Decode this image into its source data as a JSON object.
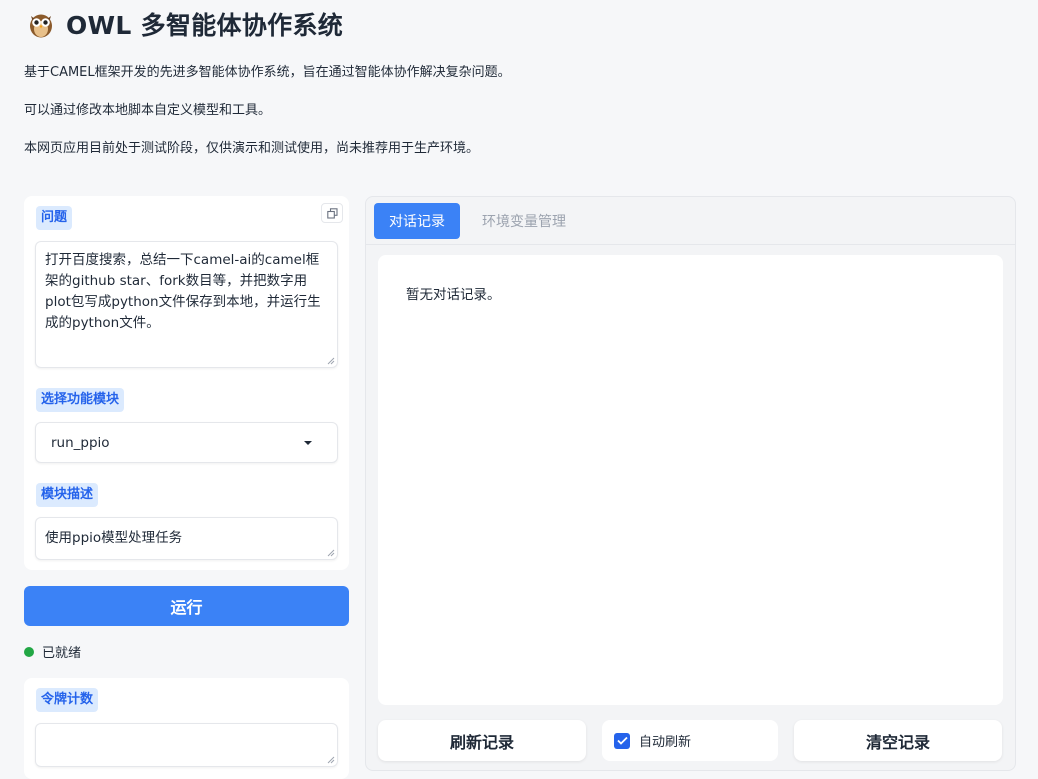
{
  "header": {
    "title": "OWL 多智能体协作系统",
    "logo_icon": "owl-emoji-icon",
    "descriptions": [
      "基于CAMEL框架开发的先进多智能体协作系统，旨在通过智能体协作解决复杂问题。",
      "可以通过修改本地脚本自定义模型和工具。",
      "本网页应用目前处于测试阶段，仅供演示和测试使用，尚未推荐用于生产环境。"
    ]
  },
  "question": {
    "label": "问题",
    "value": "打开百度搜索，总结一下camel-ai的camel框架的github star、fork数目等，并把数字用plot包写成python文件保存到本地，并运行生成的python文件。",
    "copy_icon": "copy-icon"
  },
  "module": {
    "label": "选择功能模块",
    "selected": "run_ppio"
  },
  "module_desc": {
    "label": "模块描述",
    "value": "使用ppio模型处理任务"
  },
  "run_button": "运行",
  "status": {
    "text": "已就绪",
    "color": "#22a745"
  },
  "token_count": {
    "label": "令牌计数",
    "value": ""
  },
  "tabs": [
    {
      "label": "对话记录",
      "active": true
    },
    {
      "label": "环境变量管理",
      "active": false
    }
  ],
  "chat": {
    "empty_text": "暂无对话记录。"
  },
  "actions": {
    "refresh": "刷新记录",
    "auto_refresh": "自动刷新",
    "auto_refresh_checked": true,
    "clear": "清空记录"
  },
  "colors": {
    "accent": "#3b82f6",
    "label_bg": "#dbeafe",
    "label_text": "#2563eb"
  }
}
